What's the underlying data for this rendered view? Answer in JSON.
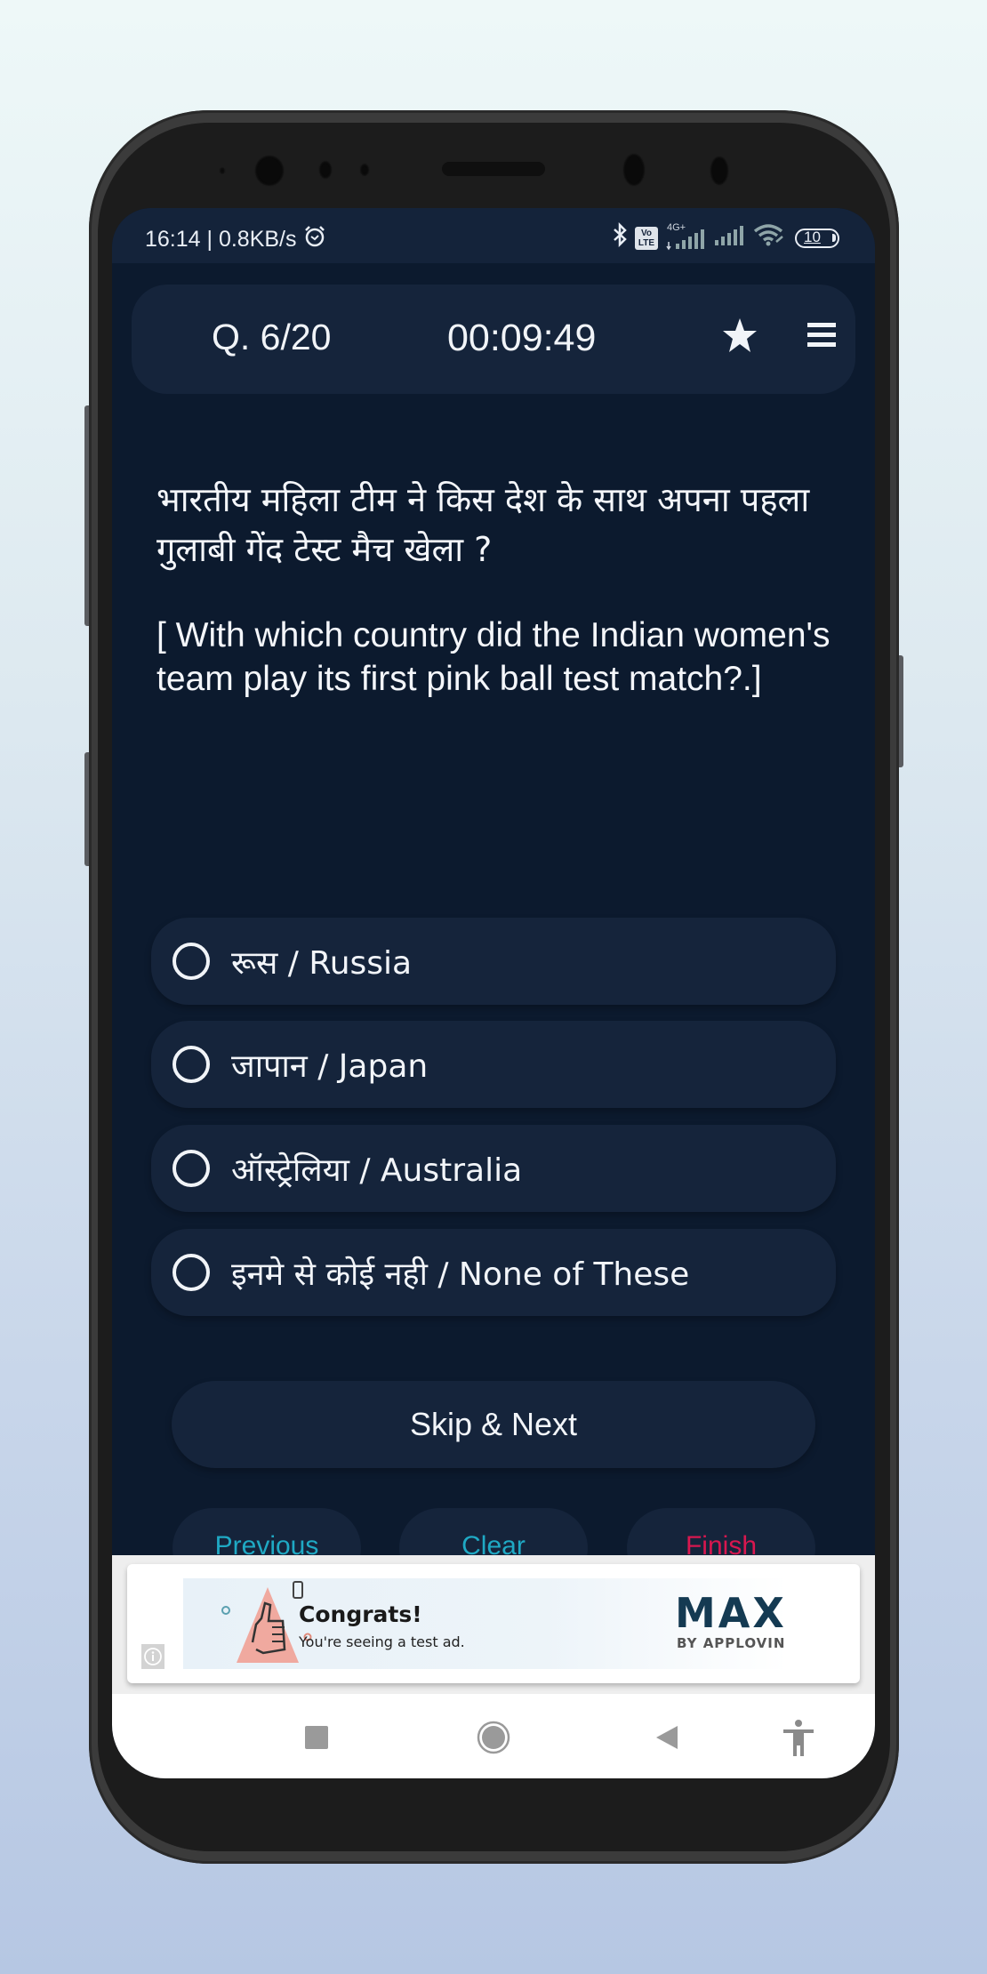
{
  "status_bar": {
    "time_speed": "16:14 | 0.8KB/s",
    "alarm_icon": "alarm-clock-icon",
    "bluetooth_icon": "bluetooth-icon",
    "volte_label_top": "Vo",
    "volte_label_bottom": "LTE",
    "network_type": "4G+",
    "battery_level": "10"
  },
  "header": {
    "question_counter": "Q. 6/20",
    "timer": "00:09:49",
    "bookmark_icon": "star-icon",
    "menu_icon": "hamburger-menu-icon"
  },
  "question": {
    "hindi": "भारतीय महिला टीम ने किस देश के साथ अपना पहला गुलाबी गेंद टेस्ट मैच खेला ?",
    "english": "[ With which country did the Indian women's team play its first pink ball test match?.]"
  },
  "options": [
    {
      "label": "रूस / Russia",
      "selected": false
    },
    {
      "label": "जापान / Japan",
      "selected": false
    },
    {
      "label": "ऑस्ट्रेलिया / Australia",
      "selected": false
    },
    {
      "label": "इनमे से कोई नही / None of These",
      "selected": false
    }
  ],
  "actions": {
    "skip_next": "Skip & Next",
    "previous": "Previous",
    "clear": "Clear",
    "finish": "Finish"
  },
  "colors": {
    "accent_cyan": "#1fa9c4",
    "finish_red": "#d8174f",
    "card_bg": "#15243b",
    "app_bg": "#0c1a2e"
  },
  "ad": {
    "title": "Congrats!",
    "subtitle": "You're seeing a test ad.",
    "brand": "MAX",
    "brand_sub": "BY APPLOVIN",
    "info_icon": "info-icon"
  },
  "navbar": {
    "recents": "recents-square-icon",
    "home": "home-circle-icon",
    "back": "back-triangle-icon",
    "accessibility": "accessibility-icon"
  }
}
